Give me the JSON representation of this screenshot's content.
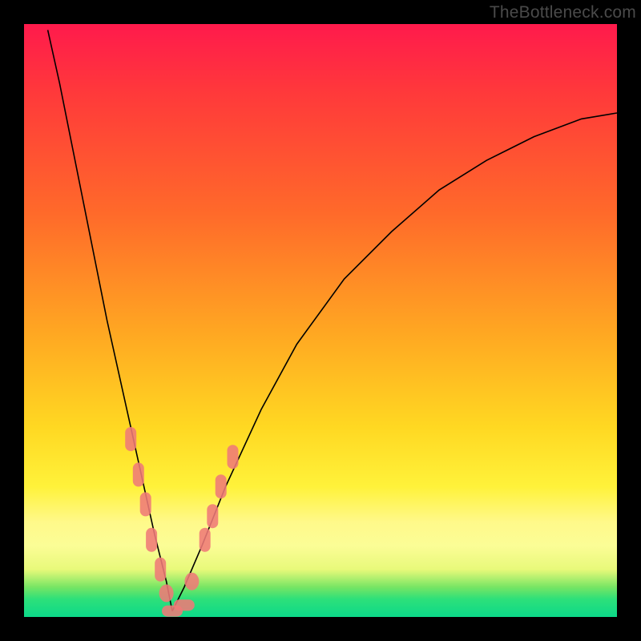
{
  "watermark_text": "TheBottleneck.com",
  "colors": {
    "gradient_top": "#ff1a4c",
    "gradient_mid1": "#ff6a2a",
    "gradient_mid2": "#ffd822",
    "gradient_mid3": "#fff98a",
    "gradient_bottom": "#0cd989",
    "curve_stroke": "#000000",
    "marker_fill": "#ef7a78",
    "frame_bg": "#000000"
  },
  "chart_data": {
    "type": "line",
    "title": "",
    "xlabel": "",
    "ylabel": "",
    "xlim": [
      0,
      100
    ],
    "ylim": [
      0,
      100
    ],
    "grid": false,
    "legend": null,
    "notes": "No axis ticks or labels rendered. Y maps qualitative scale: 0=green/good (bottom), 100=red/bad (top). Curve appears to be a bottleneck/impact curve with minimum near x≈25.",
    "series": [
      {
        "name": "curve-left",
        "x": [
          4,
          6,
          8,
          10,
          12,
          14,
          16,
          18,
          20,
          22,
          24,
          25
        ],
        "y": [
          99,
          90,
          80,
          70,
          60,
          50,
          41,
          32,
          23,
          14,
          6,
          1
        ]
      },
      {
        "name": "curve-right",
        "x": [
          25,
          27,
          30,
          34,
          40,
          46,
          54,
          62,
          70,
          78,
          86,
          94,
          100
        ],
        "y": [
          1,
          5,
          12,
          22,
          35,
          46,
          57,
          65,
          72,
          77,
          81,
          84,
          85
        ]
      }
    ],
    "markers": [
      {
        "x": 18.0,
        "y": 30,
        "series": "curve-left",
        "shape": "lozenge"
      },
      {
        "x": 19.3,
        "y": 24,
        "series": "curve-left",
        "shape": "lozenge"
      },
      {
        "x": 20.5,
        "y": 19,
        "series": "curve-left",
        "shape": "lozenge"
      },
      {
        "x": 21.5,
        "y": 13,
        "series": "curve-left",
        "shape": "lozenge"
      },
      {
        "x": 23.0,
        "y": 8,
        "series": "curve-left",
        "shape": "lozenge"
      },
      {
        "x": 24.0,
        "y": 4,
        "series": "curve-left",
        "shape": "round"
      },
      {
        "x": 25.0,
        "y": 1,
        "series": "min",
        "shape": "flat"
      },
      {
        "x": 27.0,
        "y": 2,
        "series": "min",
        "shape": "flat"
      },
      {
        "x": 28.3,
        "y": 6,
        "series": "curve-right",
        "shape": "round"
      },
      {
        "x": 30.5,
        "y": 13,
        "series": "curve-right",
        "shape": "lozenge"
      },
      {
        "x": 31.8,
        "y": 17,
        "series": "curve-right",
        "shape": "lozenge"
      },
      {
        "x": 33.2,
        "y": 22,
        "series": "curve-right",
        "shape": "lozenge"
      },
      {
        "x": 35.2,
        "y": 27,
        "series": "curve-right",
        "shape": "lozenge"
      }
    ]
  }
}
